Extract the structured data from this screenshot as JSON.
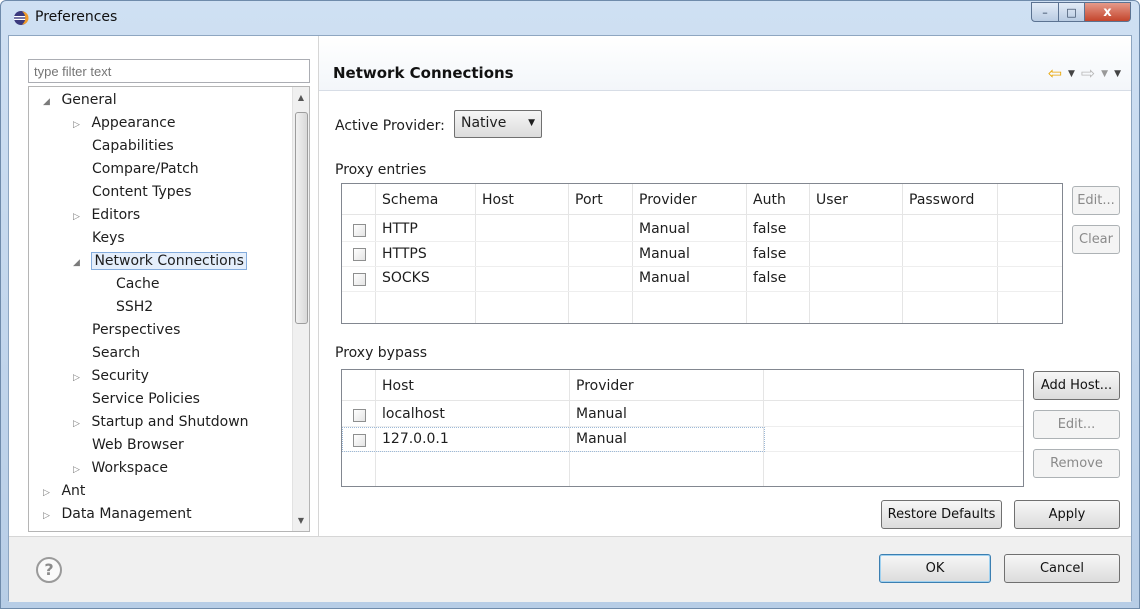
{
  "window": {
    "title": "Preferences",
    "close_glyph": "x",
    "min_glyph": "–",
    "max_glyph": "□"
  },
  "sidebar": {
    "filter_placeholder": "type filter text",
    "items": [
      {
        "label": "General",
        "expanded": true
      },
      {
        "label": "Appearance"
      },
      {
        "label": "Capabilities"
      },
      {
        "label": "Compare/Patch"
      },
      {
        "label": "Content Types"
      },
      {
        "label": "Editors"
      },
      {
        "label": "Keys"
      },
      {
        "label": "Network Connections",
        "selected": true
      },
      {
        "label": "Cache"
      },
      {
        "label": "SSH2"
      },
      {
        "label": "Perspectives"
      },
      {
        "label": "Search"
      },
      {
        "label": "Security"
      },
      {
        "label": "Service Policies"
      },
      {
        "label": "Startup and Shutdown"
      },
      {
        "label": "Web Browser"
      },
      {
        "label": "Workspace"
      },
      {
        "label": "Ant"
      },
      {
        "label": "Data Management"
      }
    ]
  },
  "page": {
    "title": "Network Connections",
    "active_provider_label": "Active Provider:",
    "active_provider_value": "Native",
    "proxy_entries": {
      "label": "Proxy entries",
      "columns": [
        "Schema",
        "Host",
        "Port",
        "Provider",
        "Auth",
        "User",
        "Password"
      ],
      "rows": [
        {
          "schema": "HTTP",
          "host": "",
          "port": "",
          "provider": "Manual",
          "auth": "false",
          "user": "",
          "password": ""
        },
        {
          "schema": "HTTPS",
          "host": "",
          "port": "",
          "provider": "Manual",
          "auth": "false",
          "user": "",
          "password": ""
        },
        {
          "schema": "SOCKS",
          "host": "",
          "port": "",
          "provider": "Manual",
          "auth": "false",
          "user": "",
          "password": ""
        }
      ],
      "buttons": {
        "edit": "Edit...",
        "clear": "Clear"
      }
    },
    "proxy_bypass": {
      "label": "Proxy bypass",
      "columns": [
        "Host",
        "Provider"
      ],
      "rows": [
        {
          "host": "localhost",
          "provider": "Manual"
        },
        {
          "host": "127.0.0.1",
          "provider": "Manual"
        }
      ],
      "buttons": {
        "add_host": "Add Host...",
        "edit": "Edit...",
        "remove": "Remove"
      }
    },
    "restore_defaults": "Restore Defaults",
    "apply": "Apply"
  },
  "footer": {
    "help_glyph": "?",
    "ok": "OK",
    "cancel": "Cancel"
  },
  "colors": {
    "selection_bg": "#e4eefb",
    "selection_border": "#84acdd",
    "nav_back": "#e8a400"
  }
}
